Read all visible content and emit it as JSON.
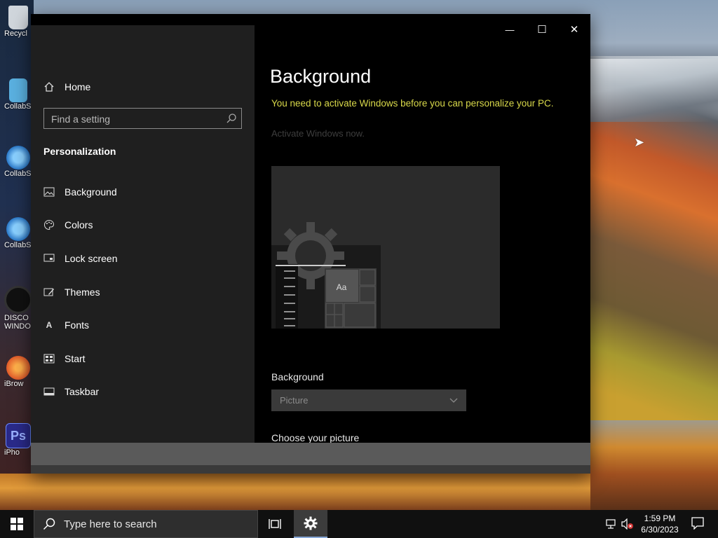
{
  "desktop": {
    "icons": [
      {
        "label": "Recycl",
        "color": "#d0d6dc"
      },
      {
        "label": "CollabS",
        "color": "#5ab0e0"
      },
      {
        "label": "CollabS Cont",
        "color": "#2a78c8"
      },
      {
        "label": "CollabS",
        "color": "#2a78c8"
      },
      {
        "label": "DISCO WINDO",
        "color": "#111111"
      },
      {
        "label": "iBrow",
        "color": "#e05a2a"
      },
      {
        "label": "iPho",
        "color": "#2a2a8a"
      }
    ]
  },
  "window": {
    "controls": {
      "minimize": "—",
      "maximize": "☐",
      "close": "✕"
    },
    "sidebar": {
      "home_label": "Home",
      "search_placeholder": "Find a setting",
      "section_title": "Personalization",
      "items": [
        {
          "label": "Background",
          "icon": "picture-icon"
        },
        {
          "label": "Colors",
          "icon": "palette-icon"
        },
        {
          "label": "Lock screen",
          "icon": "lock-screen-icon"
        },
        {
          "label": "Themes",
          "icon": "themes-icon"
        },
        {
          "label": "Fonts",
          "icon": "fonts-icon"
        },
        {
          "label": "Start",
          "icon": "start-icon"
        },
        {
          "label": "Taskbar",
          "icon": "taskbar-icon"
        }
      ]
    },
    "main": {
      "title": "Background",
      "warning": "You need to activate Windows before you can personalize your PC.",
      "activate_link": "Activate Windows now.",
      "preview_tile_text": "Aa",
      "background_label": "Background",
      "background_value": "Picture",
      "choose_label": "Choose your picture"
    }
  },
  "taskbar": {
    "search_placeholder": "Type here to search",
    "time": "1:59 PM",
    "date": "6/30/2023"
  },
  "colors": {
    "warning": "#d9d94a",
    "sidebar_bg": "#1f1f1f",
    "main_bg": "#000000",
    "taskbar_bg": "#101010"
  }
}
